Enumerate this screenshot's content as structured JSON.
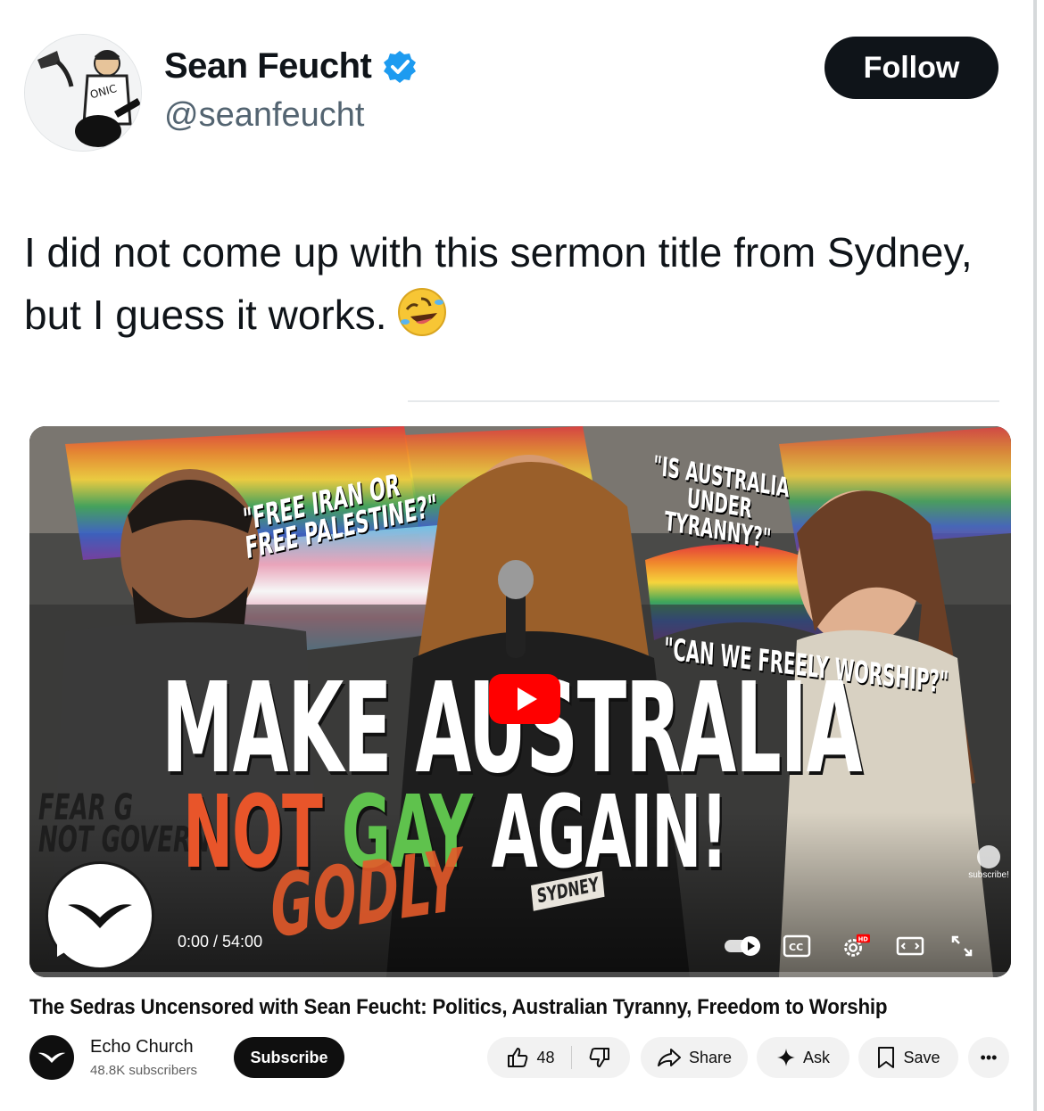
{
  "tweet": {
    "author": {
      "display_name": "Sean Feucht",
      "handle": "@seanfeucht",
      "verified": true
    },
    "follow_label": "Follow",
    "text": "I did not come up with this sermon title from Sydney, but I guess it works.",
    "emoji": "rolling-on-floor-laughing"
  },
  "video": {
    "thumbnail_text": {
      "quote_1_line_1": "\"FREE IRAN OR",
      "quote_1_line_2": "FREE PALESTINE?\"",
      "quote_2_line_1": "\"IS AUSTRALIA",
      "quote_2_line_2": "UNDER",
      "quote_2_line_3": "TYRANNY?\"",
      "quote_3": "\"CAN WE FREELY WORSHIP?\"",
      "headline_line_1": "MAKE AUSTRALIA",
      "headline_not": "NOT",
      "headline_gay": "GAY",
      "headline_again": "AGAIN!",
      "overlay_word": "GODLY",
      "sydney_tag": "SYDNEY",
      "fear_line_1": "FEAR G",
      "fear_line_2": "NOT GOVERN",
      "subscribe_mini": "subscribe!"
    },
    "time_display": "0:00 / 54:00",
    "title": "The Sedras Uncensored with Sean Feucht: Politics, Australian Tyranny, Freedom to Worship",
    "channel": {
      "name": "Echo Church",
      "subscribers": "48.8K subscribers"
    },
    "subscribe_label": "Subscribe",
    "like_count": "48",
    "share_label": "Share",
    "ask_label": "Ask",
    "save_label": "Save",
    "more_label": "•••",
    "colors": {
      "brand_red": "#ff0000",
      "verified_blue": "#1d9bf0"
    }
  }
}
